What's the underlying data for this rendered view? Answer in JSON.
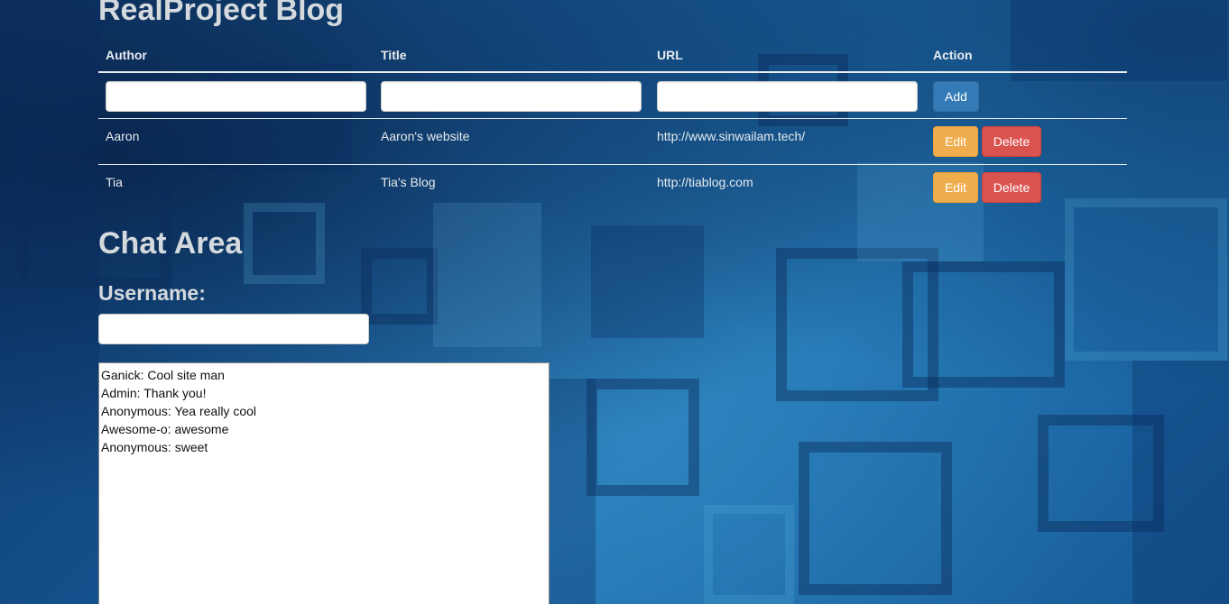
{
  "blog": {
    "title": "RealProject Blog",
    "columns": [
      "Author",
      "Title",
      "URL",
      "Action"
    ],
    "add_label": "Add",
    "entries": [
      {
        "author": "Aaron",
        "title": "Aaron's website",
        "url": "http://www.sinwailam.tech/",
        "edit_label": "Edit",
        "delete_label": "Delete"
      },
      {
        "author": "Tia",
        "title": "Tia's Blog",
        "url": "http://tiablog.com",
        "edit_label": "Edit",
        "delete_label": "Delete"
      }
    ]
  },
  "chat": {
    "title": "Chat Area",
    "username_label": "Username:",
    "username_value": "",
    "messages": [
      "Ganick: Cool site man",
      "Admin: Thank you!",
      "Anonymous: Yea really cool",
      "Awesome-o: awesome",
      "Anonymous: sweet"
    ]
  },
  "colors": {
    "primary": "#337ab7",
    "warning": "#f0ad4e",
    "danger": "#d9534f",
    "background": "#1d5f9c"
  }
}
